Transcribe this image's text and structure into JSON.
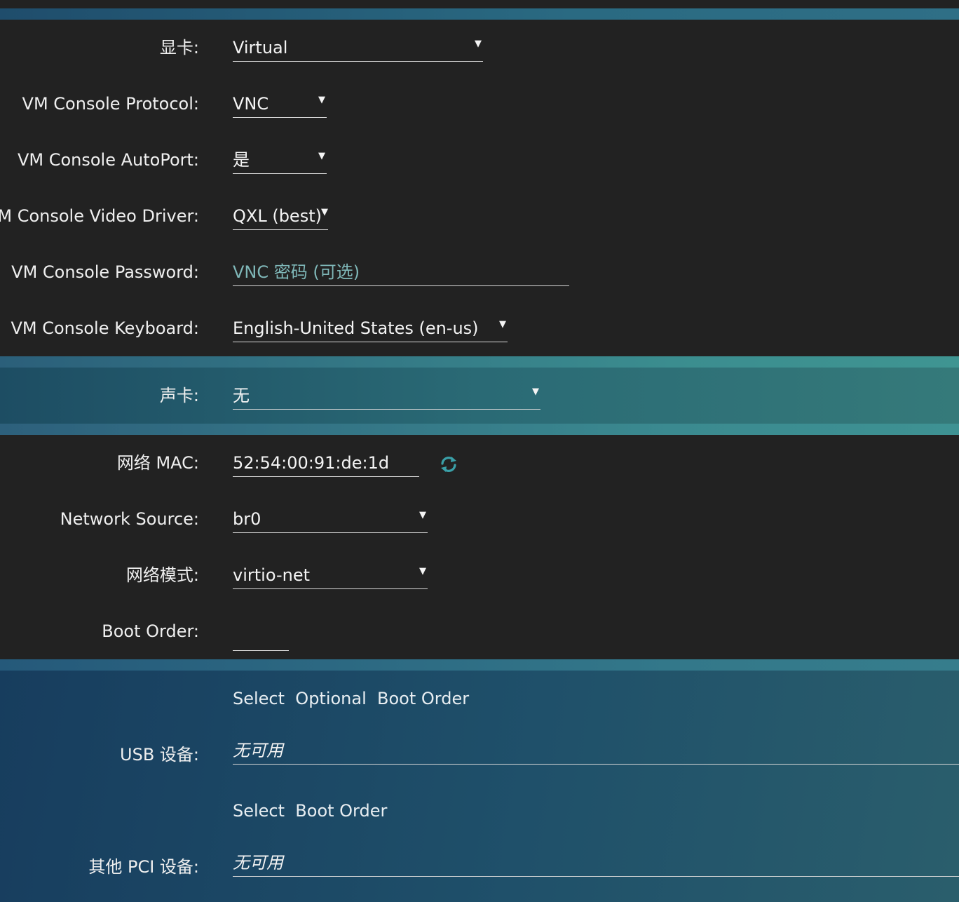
{
  "graphics": {
    "label": "显卡:",
    "value": "Virtual"
  },
  "console_protocol": {
    "label": "VM Console Protocol:",
    "value": "VNC"
  },
  "console_autoport": {
    "label": "VM Console AutoPort:",
    "value": "是"
  },
  "console_video_driver": {
    "label": "VM Console Video Driver:",
    "value": "QXL (best)"
  },
  "console_password": {
    "label": "VM Console Password:",
    "placeholder": "VNC 密码 (可选)"
  },
  "console_keyboard": {
    "label": "VM Console Keyboard:",
    "value": "English-United States (en-us)"
  },
  "sound": {
    "label": "声卡:",
    "value": "无"
  },
  "network_mac": {
    "label": "网络 MAC:",
    "value": "52:54:00:91:de:1d",
    "refresh_icon": "refresh-icon"
  },
  "network_source": {
    "label": "Network Source:",
    "value": "br0"
  },
  "network_mode": {
    "label": "网络模式:",
    "value": "virtio-net"
  },
  "boot_order": {
    "label": "Boot Order:",
    "value": ""
  },
  "usb": {
    "links": "Select  Optional  Boot Order",
    "label": "USB 设备:",
    "value": "无可用"
  },
  "pci": {
    "links": "Select  Boot Order",
    "label": "其他 PCI 设备:",
    "value": "无可用"
  },
  "colors": {
    "background": "#222222",
    "accent_band": "#2a6a82",
    "placeholder": "#7fb7b8",
    "refresh_icon": "#3aa0a8"
  }
}
